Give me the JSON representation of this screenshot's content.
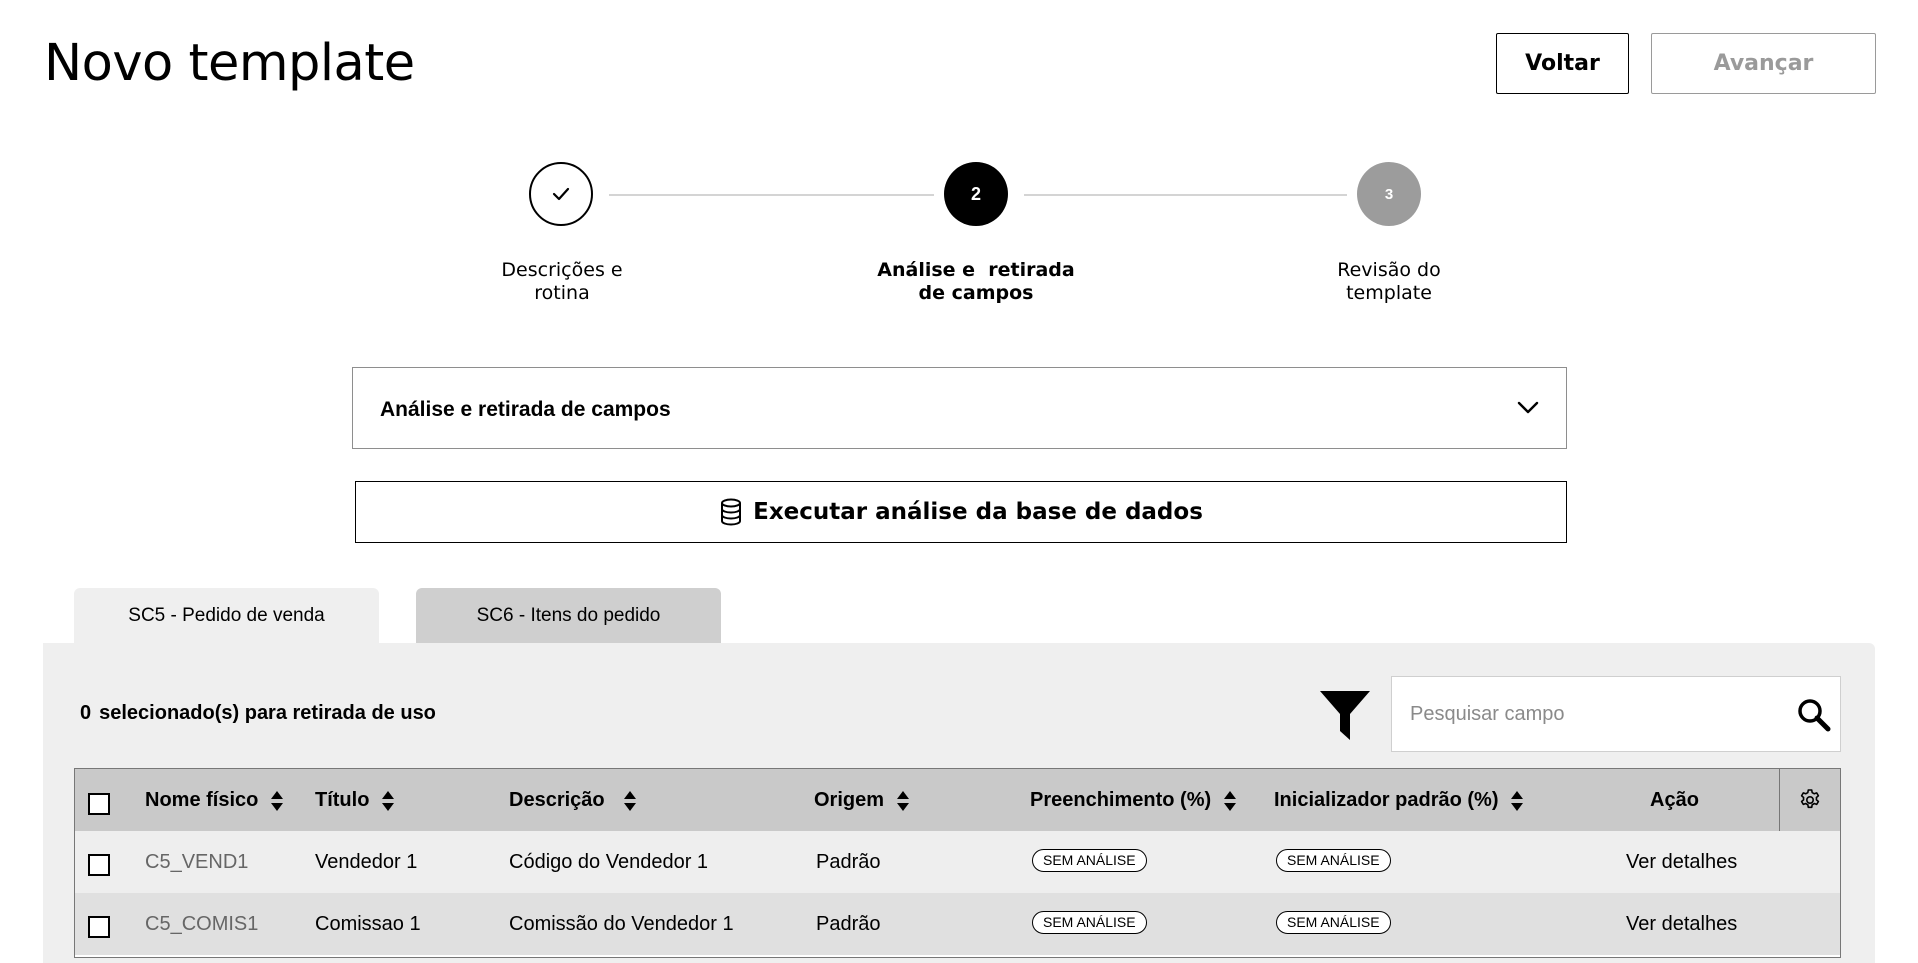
{
  "header": {
    "title": "Novo template",
    "back_label": "Voltar",
    "next_label": "Avançar"
  },
  "stepper": {
    "steps": [
      {
        "number": "",
        "label_line1": "Descrições e",
        "label_line2": "rotina",
        "state": "done"
      },
      {
        "number": "2",
        "label_line1": "Análise e  retirada",
        "label_line2": "de campos",
        "state": "active"
      },
      {
        "number": "3",
        "label_line1": "Revisão do",
        "label_line2": "template",
        "state": "pending"
      }
    ]
  },
  "section": {
    "dropdown_label": "Análise e retirada de campos",
    "execute_label": "Executar análise da base de dados"
  },
  "tabs": [
    {
      "label": "SC5 - Pedido de venda",
      "selected": true
    },
    {
      "label": "SC6 - Itens do pedido",
      "selected": false
    }
  ],
  "toolbar": {
    "selected_count": "0",
    "selected_text": "selecionado(s) para retirada de uso",
    "search_placeholder": "Pesquisar campo"
  },
  "table": {
    "headers": {
      "nome": "Nome físico",
      "titulo": "Título",
      "descricao": "Descrição",
      "origem": "Origem",
      "preenchimento": "Preenchimento (%)",
      "inicializador": "Inicializador padrão (%)",
      "acao": "Ação"
    },
    "rows": [
      {
        "nome": "C5_VEND1",
        "titulo": "Vendedor 1",
        "descricao": "Código do Vendedor 1",
        "origem": "Padrão",
        "preenchimento": "SEM ANÁLISE",
        "inicializador": "SEM ANÁLISE",
        "acao": "Ver detalhes"
      },
      {
        "nome": "C5_COMIS1",
        "titulo": "Comissao 1",
        "descricao": "Comissão do Vendedor 1",
        "origem": "Padrão",
        "preenchimento": "SEM ANÁLISE",
        "inicializador": "SEM ANÁLISE",
        "acao": "Ver detalhes"
      }
    ]
  },
  "colors": {
    "active_step": "#000000",
    "pending_step": "#9c9c9c",
    "header_bg": "#c9c9c9",
    "panel_bg": "#efefef",
    "disabled_text": "#9a9a9a"
  }
}
